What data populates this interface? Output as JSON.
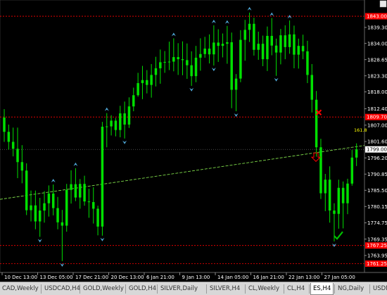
{
  "window": {
    "title": "ES,H4"
  },
  "chart_data": {
    "type": "candlestick",
    "symbol": "ES",
    "timeframe": "H4",
    "colors": {
      "background": "#000000",
      "candle": "#00e000",
      "axis_text": "#ffffff",
      "resistance_line": "#ff0000",
      "trendline": "#7fdc4a",
      "fractal_arrow": "#4fa8d8",
      "sell_marker": "#ff0000",
      "buy_marker": "#00c000",
      "price_label_bg": "#ff0000",
      "current_price_bg": "#ffffff",
      "fib_label": "#ffff00"
    },
    "y_axis": {
      "ticks": [
        "1839.30",
        "1834.00",
        "1828.65",
        "1823.30",
        "1818.00",
        "1812.40",
        "1807.00",
        "1801.60",
        "1796.20",
        "1790.85",
        "1785.50",
        "1780.15",
        "1774.75",
        "1769.35",
        "1763.95"
      ],
      "range": [
        1759.5,
        1846.5
      ]
    },
    "x_axis": {
      "ticks": [
        "10 Dec 13:00",
        "13 Dec 05:00",
        "17 Dec 21:00",
        "20 Dec 13:00",
        "6 Jan 21:00",
        "9 Jan 13:00",
        "14 Jan 05:00",
        "16 Jan 21:00",
        "22 Jan 13:00",
        "27 Jan 05:00"
      ]
    },
    "horizontal_lines": [
      {
        "price": 1843.0,
        "label": "1843.00",
        "color": "#ff0000"
      },
      {
        "price": 1809.7,
        "label": "1809.70",
        "color": "#ff0000"
      },
      {
        "price": 1767.25,
        "label": "1767.25",
        "color": "#ff0000"
      },
      {
        "price": 1761.25,
        "label": "1761.25",
        "color": "#ff0000"
      }
    ],
    "fib_level": {
      "label": "161.8",
      "price": 1805.5
    },
    "current_price": {
      "label": "1799.00",
      "price": 1799.0
    },
    "trendline": {
      "start_price": 1782.5,
      "end_price": 1800.3
    },
    "sell_marker": {
      "price": 1811.2
    },
    "buy_marker": {
      "price": 1770.4
    },
    "candles": [
      [
        1809.5,
        1812.3,
        1801.5,
        1804.8
      ],
      [
        1804.8,
        1807.2,
        1798.9,
        1801.5
      ],
      [
        1801.5,
        1806.2,
        1796.7,
        1799.2
      ],
      [
        1799.2,
        1806.2,
        1789.5,
        1794.8
      ],
      [
        1794.8,
        1800.4,
        1787.8,
        1792.0
      ],
      [
        1792.0,
        1794.4,
        1777.3,
        1778.9
      ],
      [
        1778.9,
        1785.4,
        1775.2,
        1780.5
      ],
      [
        1780.5,
        1785.4,
        1772.6,
        1775.2
      ],
      [
        1775.2,
        1783.0,
        1770.1,
        1778.8
      ],
      [
        1778.8,
        1785.2,
        1774.8,
        1781.2
      ],
      [
        1781.2,
        1787.1,
        1776.8,
        1784.4
      ],
      [
        1784.4,
        1787.4,
        1777.2,
        1779.6
      ],
      [
        1779.6,
        1783.3,
        1772.6,
        1774.9
      ],
      [
        1774.9,
        1779.0,
        1762.1,
        1773.8
      ],
      [
        1773.8,
        1787.6,
        1771.8,
        1785.6
      ],
      [
        1785.6,
        1792.1,
        1781.1,
        1787.5
      ],
      [
        1787.5,
        1792.8,
        1781.9,
        1783.1
      ],
      [
        1783.1,
        1789.2,
        1779.4,
        1787.6
      ],
      [
        1787.6,
        1790.3,
        1780.4,
        1781.8
      ],
      [
        1781.8,
        1786.0,
        1776.4,
        1781.6
      ],
      [
        1781.6,
        1786.5,
        1774.5,
        1779.4
      ],
      [
        1779.4,
        1780.4,
        1770.6,
        1773.5
      ],
      [
        1773.5,
        1808.1,
        1770.5,
        1806.5
      ],
      [
        1806.5,
        1811.0,
        1799.7,
        1806.6
      ],
      [
        1806.6,
        1810.3,
        1803.6,
        1808.5
      ],
      [
        1808.5,
        1809.4,
        1803.3,
        1805.4
      ],
      [
        1805.4,
        1813.4,
        1803.0,
        1810.9
      ],
      [
        1810.9,
        1814.8,
        1802.6,
        1807.2
      ],
      [
        1807.2,
        1816.2,
        1806.1,
        1813.2
      ],
      [
        1813.2,
        1819.4,
        1811.6,
        1816.9
      ],
      [
        1816.9,
        1824.3,
        1816.4,
        1820.9
      ],
      [
        1820.9,
        1826.6,
        1815.6,
        1821.9
      ],
      [
        1821.9,
        1825.2,
        1817.5,
        1820.3
      ],
      [
        1820.3,
        1827.2,
        1816.1,
        1823.6
      ],
      [
        1823.6,
        1829.6,
        1819.8,
        1825.8
      ],
      [
        1825.8,
        1832.0,
        1820.7,
        1827.8
      ],
      [
        1827.8,
        1831.5,
        1824.3,
        1827.9
      ],
      [
        1827.9,
        1834.6,
        1825.2,
        1828.0
      ],
      [
        1828.0,
        1835.7,
        1824.8,
        1829.5
      ],
      [
        1829.5,
        1834.1,
        1823.6,
        1828.8
      ],
      [
        1828.8,
        1834.7,
        1823.5,
        1828.5
      ],
      [
        1828.5,
        1834.0,
        1822.3,
        1826.8
      ],
      [
        1826.8,
        1831.4,
        1820.0,
        1823.2
      ],
      [
        1823.2,
        1833.2,
        1821.2,
        1829.3
      ],
      [
        1829.3,
        1835.7,
        1825.0,
        1830.5
      ],
      [
        1830.5,
        1836.2,
        1829.3,
        1832.3
      ],
      [
        1832.3,
        1837.0,
        1827.4,
        1830.4
      ],
      [
        1830.4,
        1840.0,
        1826.7,
        1834.3
      ],
      [
        1834.3,
        1838.7,
        1827.9,
        1833.2
      ],
      [
        1833.2,
        1837.3,
        1829.4,
        1833.9
      ],
      [
        1833.9,
        1839.8,
        1827.3,
        1834.4
      ],
      [
        1834.4,
        1837.6,
        1812.6,
        1818.7
      ],
      [
        1818.7,
        1823.9,
        1811.6,
        1822.4
      ],
      [
        1822.4,
        1838.4,
        1821.2,
        1835.2
      ],
      [
        1835.2,
        1841.8,
        1828.3,
        1838.5
      ],
      [
        1838.5,
        1844.2,
        1834.5,
        1840.5
      ],
      [
        1840.5,
        1842.5,
        1830.0,
        1831.9
      ],
      [
        1831.9,
        1837.9,
        1828.6,
        1833.9
      ],
      [
        1833.9,
        1836.6,
        1826.5,
        1828.8
      ],
      [
        1828.8,
        1839.6,
        1824.9,
        1836.5
      ],
      [
        1836.5,
        1842.4,
        1830.1,
        1833.3
      ],
      [
        1833.3,
        1835.6,
        1823.3,
        1831.0
      ],
      [
        1831.0,
        1838.8,
        1827.1,
        1836.7
      ],
      [
        1836.7,
        1840.0,
        1828.8,
        1832.8
      ],
      [
        1832.8,
        1841.6,
        1830.6,
        1837.0
      ],
      [
        1837.0,
        1839.9,
        1825.8,
        1830.3
      ],
      [
        1830.3,
        1835.6,
        1825.7,
        1833.2
      ],
      [
        1833.2,
        1836.9,
        1828.8,
        1831.4
      ],
      [
        1831.4,
        1834.9,
        1820.9,
        1823.6
      ],
      [
        1823.6,
        1827.2,
        1811.2,
        1815.4
      ],
      [
        1815.4,
        1818.3,
        1796.6,
        1799.7
      ],
      [
        1799.7,
        1802.5,
        1782.6,
        1784.5
      ],
      [
        1784.5,
        1790.9,
        1778.6,
        1789.0
      ],
      [
        1789.0,
        1793.4,
        1774.8,
        1778.8
      ],
      [
        1778.8,
        1781.2,
        1768.6,
        1777.7
      ],
      [
        1777.7,
        1789.0,
        1772.8,
        1786.3
      ],
      [
        1786.3,
        1788.4,
        1772.9,
        1781.2
      ],
      [
        1781.2,
        1789.3,
        1777.6,
        1787.7
      ],
      [
        1787.7,
        1798.8,
        1787.0,
        1796.3
      ],
      [
        1796.3,
        1801.0,
        1793.5,
        1799.0
      ]
    ]
  },
  "tabs": [
    {
      "label": "CAD,Weekly",
      "active": false
    },
    {
      "label": "USDCAD,H4",
      "active": false
    },
    {
      "label": "GOLD,Weekly",
      "active": false
    },
    {
      "label": "GOLD,H4",
      "active": false
    },
    {
      "label": "SILVER,Daily",
      "active": false
    },
    {
      "label": "SILVER,H4",
      "active": false
    },
    {
      "label": "CL,Weekly",
      "active": false
    },
    {
      "label": "CL,H4",
      "active": false
    },
    {
      "label": "ES,H4",
      "active": true
    },
    {
      "label": "NG,Daily",
      "active": false
    },
    {
      "label": "USDMXN,H",
      "active": false
    }
  ]
}
